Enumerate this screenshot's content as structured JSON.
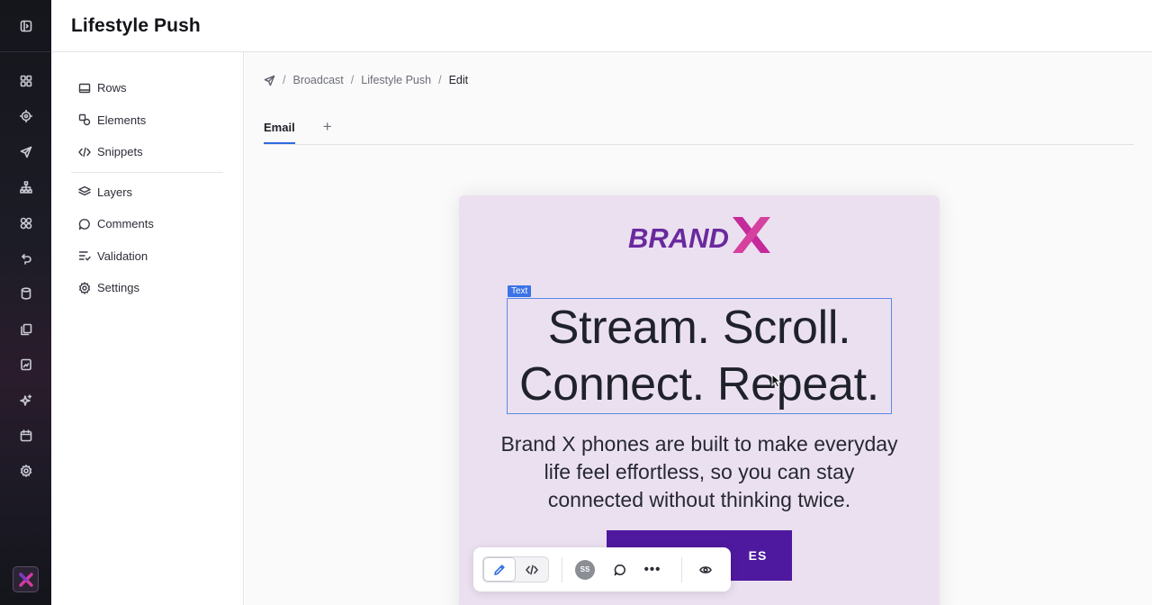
{
  "header": {
    "title": "Lifestyle Push"
  },
  "rail": {
    "icons": [
      "panel-toggle-icon",
      "dashboard-icon",
      "target-icon",
      "send-icon",
      "hierarchy-icon",
      "components-icon",
      "undo-flow-icon",
      "database-icon",
      "copy-icon",
      "file-chart-icon",
      "sparkle-icon",
      "calendar-icon",
      "settings-icon"
    ],
    "logo_letter": "X"
  },
  "left_panel": {
    "items_top": [
      {
        "label": "Rows",
        "icon": "rows-icon"
      },
      {
        "label": "Elements",
        "icon": "elements-icon"
      },
      {
        "label": "Snippets",
        "icon": "code-icon"
      }
    ],
    "items_bottom": [
      {
        "label": "Layers",
        "icon": "layers-icon"
      },
      {
        "label": "Comments",
        "icon": "comment-icon"
      },
      {
        "label": "Validation",
        "icon": "validation-icon"
      },
      {
        "label": "Settings",
        "icon": "settings-icon"
      }
    ]
  },
  "breadcrumb": {
    "items": [
      "Broadcast",
      "Lifestyle Push"
    ],
    "current": "Edit",
    "separator": "/"
  },
  "tabs": {
    "items": [
      "Email"
    ],
    "add_label": "+"
  },
  "email": {
    "brand": {
      "part1": "BRAND",
      "part2": "X"
    },
    "text_tag": "Text",
    "headline_line1": "Stream. Scroll.",
    "headline_line2": "Connect. Repeat.",
    "body": "Brand X phones are built to make everyday life feel effortless, so you can stay connected without thinking twice.",
    "cta_visible": "ES"
  },
  "toolbar": {
    "avatar_initials": "SS",
    "more_label": "•••"
  },
  "colors": {
    "accent": "#2f6bdf",
    "cta": "#4f199f",
    "card_bg": "#ebe0f0",
    "brand_purple": "#6a2a9e",
    "brand_pink": "#c52a9a"
  }
}
